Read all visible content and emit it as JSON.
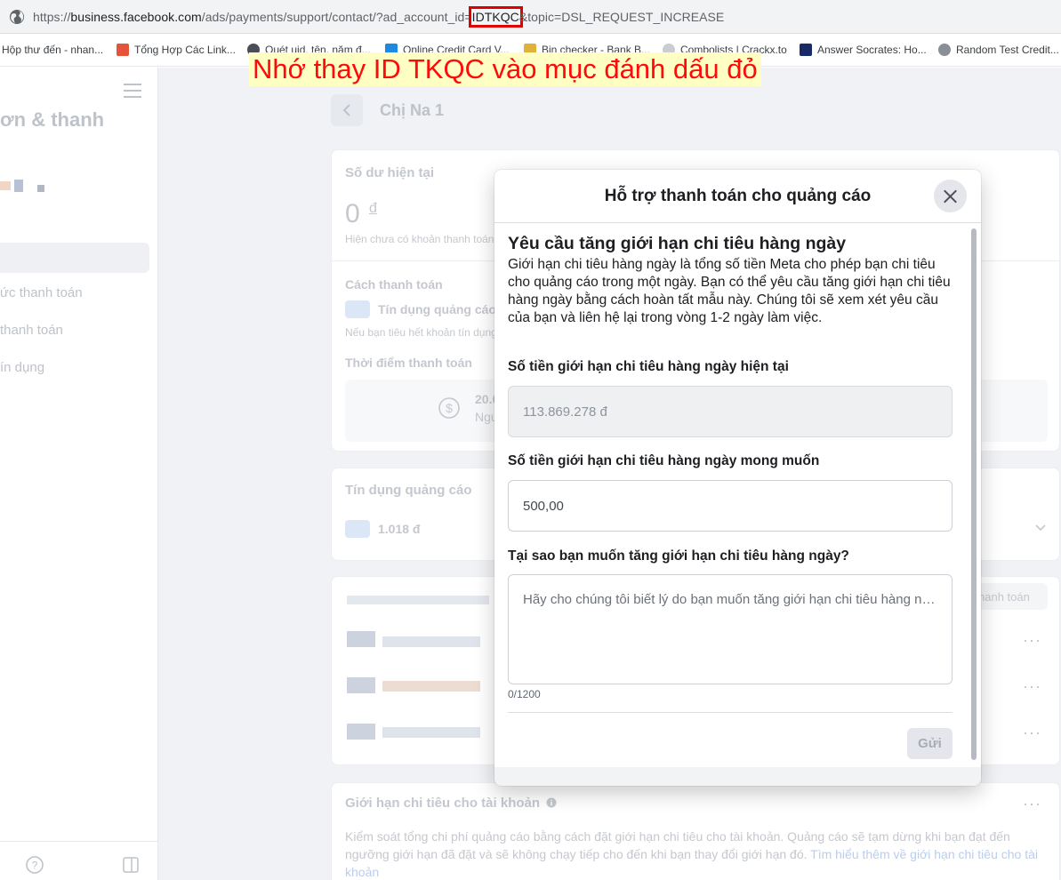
{
  "browser": {
    "url_prefix": "https://",
    "url_domain": "business.facebook.com",
    "url_path": "/ads/payments/support/contact/?ad_account_id=",
    "url_highlight": "IDTKQC",
    "url_suffix": "&topic=DSL_REQUEST_INCREASE",
    "bookmarks": [
      "Hộp thư đến - nhan...",
      "Tổng Hợp Các Link...",
      "Quét uid, tên, năm đ...",
      "Online Credit Card V...",
      "Bin checker - Bank B...",
      "Combolists | Crackx.to",
      "Answer Socrates: Ho...",
      "Random Test Credit..."
    ]
  },
  "annotation": "Nhớ thay ID TKQC vào mục đánh dấu đỏ",
  "sidebar": {
    "title": "ơn & thanh",
    "items": [
      "ức thanh toán",
      "thanh toán",
      "ín dụng"
    ]
  },
  "background": {
    "title": "Chị Na 1",
    "balance_label": "Số dư hiện tại",
    "balance_value": "0",
    "balance_currency": "đ",
    "balance_note": "Hiện chưa có khoản thanh toán",
    "payment_method_label": "Cách thanh toán",
    "payment_method_value": "Tín dụng quảng cáo",
    "payment_method_note": "Nếu bạn tiêu hết khoản tín dụng",
    "payment_time_label": "Thời điểm thanh toán",
    "payment_time_amount": "20.0",
    "payment_time_note": "Ngư",
    "ad_credit_label": "Tín dụng quảng cáo",
    "ad_credit_value": "1.018 đ",
    "pay_button": "hanh toán",
    "limit_title": "Giới hạn chi tiêu cho tài khoản",
    "limit_desc": "Kiểm soát tổng chi phí quảng cáo bằng cách đặt giới hạn chi tiêu cho tài khoản. Quảng cáo sẽ tạm dừng khi bạn đạt đến ngưỡng giới hạn đã đặt và sẽ không chạy tiếp cho đến khi bạn thay đổi giới hạn đó.",
    "limit_link": "Tìm hiểu thêm về giới hạn chi tiêu cho tài khoản"
  },
  "modal": {
    "title": "Hỗ trợ thanh toán cho quảng cáo",
    "heading": "Yêu cầu tăng giới hạn chi tiêu hàng ngày",
    "description": "Giới hạn chi tiêu hàng ngày là tổng số tiền Meta cho phép bạn chi tiêu cho quảng cáo trong một ngày. Bạn có thể yêu cầu tăng giới hạn chi tiêu hàng ngày bằng cách hoàn tất mẫu này. Chúng tôi sẽ xem xét yêu cầu của bạn và liên hệ lại trong vòng 1-2 ngày làm việc.",
    "current_label": "Số tiền giới hạn chi tiêu hàng ngày hiện tại",
    "current_value": "113.869.278 đ",
    "desired_label": "Số tiền giới hạn chi tiêu hàng ngày mong muốn",
    "desired_value": "500,00",
    "reason_label": "Tại sao bạn muốn tăng giới hạn chi tiêu hàng ngày?",
    "reason_placeholder": "Hãy cho chúng tôi biết lý do bạn muốn tăng giới hạn chi tiêu hàng ngày",
    "counter": "0/1200",
    "submit": "Gửi"
  }
}
